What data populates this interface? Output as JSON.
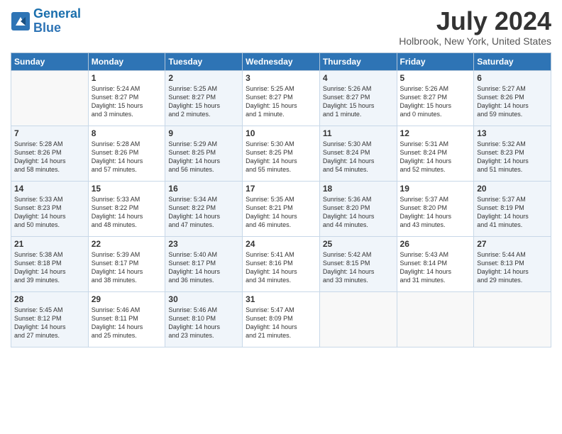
{
  "header": {
    "logo_line1": "General",
    "logo_line2": "Blue",
    "title": "July 2024",
    "location": "Holbrook, New York, United States"
  },
  "days_of_week": [
    "Sunday",
    "Monday",
    "Tuesday",
    "Wednesday",
    "Thursday",
    "Friday",
    "Saturday"
  ],
  "weeks": [
    [
      {
        "day": "",
        "text": ""
      },
      {
        "day": "1",
        "text": "Sunrise: 5:24 AM\nSunset: 8:27 PM\nDaylight: 15 hours\nand 3 minutes."
      },
      {
        "day": "2",
        "text": "Sunrise: 5:25 AM\nSunset: 8:27 PM\nDaylight: 15 hours\nand 2 minutes."
      },
      {
        "day": "3",
        "text": "Sunrise: 5:25 AM\nSunset: 8:27 PM\nDaylight: 15 hours\nand 1 minute."
      },
      {
        "day": "4",
        "text": "Sunrise: 5:26 AM\nSunset: 8:27 PM\nDaylight: 15 hours\nand 1 minute."
      },
      {
        "day": "5",
        "text": "Sunrise: 5:26 AM\nSunset: 8:27 PM\nDaylight: 15 hours\nand 0 minutes."
      },
      {
        "day": "6",
        "text": "Sunrise: 5:27 AM\nSunset: 8:26 PM\nDaylight: 14 hours\nand 59 minutes."
      }
    ],
    [
      {
        "day": "7",
        "text": "Sunrise: 5:28 AM\nSunset: 8:26 PM\nDaylight: 14 hours\nand 58 minutes."
      },
      {
        "day": "8",
        "text": "Sunrise: 5:28 AM\nSunset: 8:26 PM\nDaylight: 14 hours\nand 57 minutes."
      },
      {
        "day": "9",
        "text": "Sunrise: 5:29 AM\nSunset: 8:25 PM\nDaylight: 14 hours\nand 56 minutes."
      },
      {
        "day": "10",
        "text": "Sunrise: 5:30 AM\nSunset: 8:25 PM\nDaylight: 14 hours\nand 55 minutes."
      },
      {
        "day": "11",
        "text": "Sunrise: 5:30 AM\nSunset: 8:24 PM\nDaylight: 14 hours\nand 54 minutes."
      },
      {
        "day": "12",
        "text": "Sunrise: 5:31 AM\nSunset: 8:24 PM\nDaylight: 14 hours\nand 52 minutes."
      },
      {
        "day": "13",
        "text": "Sunrise: 5:32 AM\nSunset: 8:23 PM\nDaylight: 14 hours\nand 51 minutes."
      }
    ],
    [
      {
        "day": "14",
        "text": "Sunrise: 5:33 AM\nSunset: 8:23 PM\nDaylight: 14 hours\nand 50 minutes."
      },
      {
        "day": "15",
        "text": "Sunrise: 5:33 AM\nSunset: 8:22 PM\nDaylight: 14 hours\nand 48 minutes."
      },
      {
        "day": "16",
        "text": "Sunrise: 5:34 AM\nSunset: 8:22 PM\nDaylight: 14 hours\nand 47 minutes."
      },
      {
        "day": "17",
        "text": "Sunrise: 5:35 AM\nSunset: 8:21 PM\nDaylight: 14 hours\nand 46 minutes."
      },
      {
        "day": "18",
        "text": "Sunrise: 5:36 AM\nSunset: 8:20 PM\nDaylight: 14 hours\nand 44 minutes."
      },
      {
        "day": "19",
        "text": "Sunrise: 5:37 AM\nSunset: 8:20 PM\nDaylight: 14 hours\nand 43 minutes."
      },
      {
        "day": "20",
        "text": "Sunrise: 5:37 AM\nSunset: 8:19 PM\nDaylight: 14 hours\nand 41 minutes."
      }
    ],
    [
      {
        "day": "21",
        "text": "Sunrise: 5:38 AM\nSunset: 8:18 PM\nDaylight: 14 hours\nand 39 minutes."
      },
      {
        "day": "22",
        "text": "Sunrise: 5:39 AM\nSunset: 8:17 PM\nDaylight: 14 hours\nand 38 minutes."
      },
      {
        "day": "23",
        "text": "Sunrise: 5:40 AM\nSunset: 8:17 PM\nDaylight: 14 hours\nand 36 minutes."
      },
      {
        "day": "24",
        "text": "Sunrise: 5:41 AM\nSunset: 8:16 PM\nDaylight: 14 hours\nand 34 minutes."
      },
      {
        "day": "25",
        "text": "Sunrise: 5:42 AM\nSunset: 8:15 PM\nDaylight: 14 hours\nand 33 minutes."
      },
      {
        "day": "26",
        "text": "Sunrise: 5:43 AM\nSunset: 8:14 PM\nDaylight: 14 hours\nand 31 minutes."
      },
      {
        "day": "27",
        "text": "Sunrise: 5:44 AM\nSunset: 8:13 PM\nDaylight: 14 hours\nand 29 minutes."
      }
    ],
    [
      {
        "day": "28",
        "text": "Sunrise: 5:45 AM\nSunset: 8:12 PM\nDaylight: 14 hours\nand 27 minutes."
      },
      {
        "day": "29",
        "text": "Sunrise: 5:46 AM\nSunset: 8:11 PM\nDaylight: 14 hours\nand 25 minutes."
      },
      {
        "day": "30",
        "text": "Sunrise: 5:46 AM\nSunset: 8:10 PM\nDaylight: 14 hours\nand 23 minutes."
      },
      {
        "day": "31",
        "text": "Sunrise: 5:47 AM\nSunset: 8:09 PM\nDaylight: 14 hours\nand 21 minutes."
      },
      {
        "day": "",
        "text": ""
      },
      {
        "day": "",
        "text": ""
      },
      {
        "day": "",
        "text": ""
      }
    ]
  ]
}
